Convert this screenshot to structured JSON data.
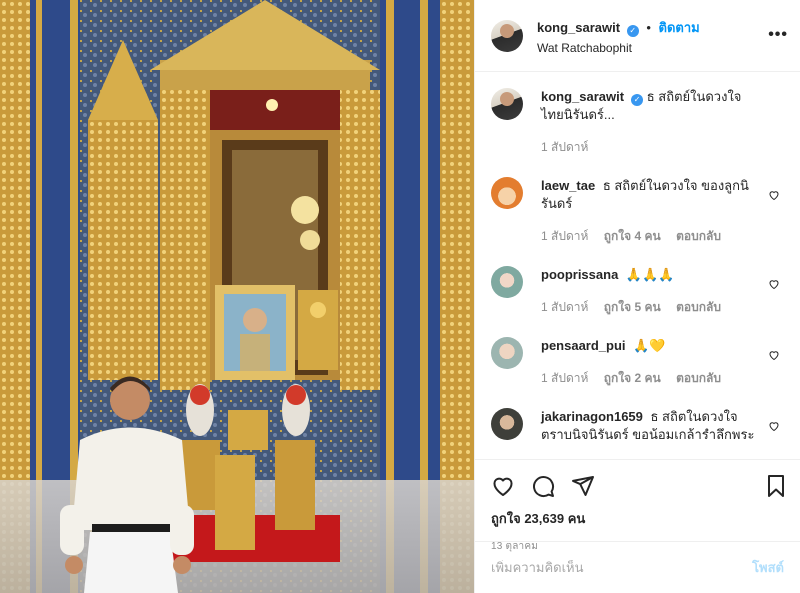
{
  "post": {
    "owner": {
      "username": "kong_sarawit",
      "verified_icon": "verified-badge-icon",
      "follow_label": "ติดตาม",
      "location": "Wat Ratchabophit"
    },
    "more_icon": "more-options-icon",
    "caption": {
      "username": "kong_sarawit",
      "text": "ธ สถิตย์ในดวงใจไทยนิรันดร์...",
      "time": "1 สัปดาห์"
    },
    "comments": [
      {
        "username": "laew_tae",
        "text": "ธ สถิตย์ในดวงใจ ของลูกนิรันดร์",
        "time": "1 สัปดาห์",
        "likes": "ถูกใจ 4 คน",
        "reply": "ตอบกลับ"
      },
      {
        "username": "pooprissana",
        "text": "🙏🙏🙏",
        "time": "1 สัปดาห์",
        "likes": "ถูกใจ 5 คน",
        "reply": "ตอบกลับ"
      },
      {
        "username": "pensaard_pui",
        "text": "🙏💛",
        "time": "1 สัปดาห์",
        "likes": "ถูกใจ 2 คน",
        "reply": "ตอบกลับ"
      },
      {
        "username": "jakarinagon1659",
        "text": "ธ สถิตในดวงใจตราบนิจนิรันดร์ ขอน้อมเกล้ารำลึกพระ"
      }
    ],
    "actions": {
      "like_icon": "heart-icon",
      "comment_icon": "comment-icon",
      "share_icon": "paper-plane-icon",
      "save_icon": "bookmark-icon"
    },
    "likes_text": "ถูกใจ 23,639 คน",
    "date": "13 ตุลาคม",
    "add_comment": {
      "placeholder": "เพิ่มความคิดเห็น",
      "post_label": "โพสต์"
    }
  }
}
